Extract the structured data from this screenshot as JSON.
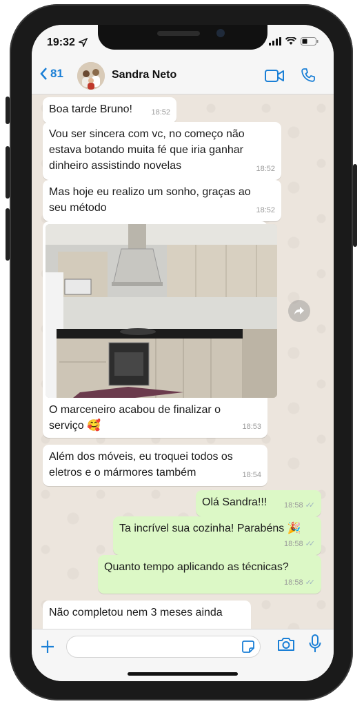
{
  "status": {
    "time": "19:32"
  },
  "header": {
    "back_count": "81",
    "contact_name": "Sandra Neto"
  },
  "messages": [
    {
      "dir": "in",
      "text": "Boa tarde Bruno!",
      "time": "18:52"
    },
    {
      "dir": "in",
      "text": "Vou ser sincera com vc, no começo não estava botando muita fé que iria ganhar dinheiro assistindo novelas",
      "time": "18:52"
    },
    {
      "dir": "in",
      "text": "Mas hoje eu realizo um sonho, graças ao seu método",
      "time": "18:52"
    },
    {
      "dir": "in",
      "type": "image",
      "caption": "O marceneiro acabou de finalizar o serviço 🥰",
      "time": "18:53"
    },
    {
      "dir": "in",
      "text": "Além dos móveis, eu troquei todos os eletros e o mármores também",
      "time": "18:54"
    },
    {
      "dir": "out",
      "text": "Olá Sandra!!!",
      "time": "18:58"
    },
    {
      "dir": "out",
      "text": "Ta incrível sua cozinha! Parabéns 🎉",
      "time": "18:58"
    },
    {
      "dir": "out",
      "text": "Quanto tempo aplicando as técnicas?",
      "time": "18:58"
    },
    {
      "dir": "in",
      "text": "Não completou nem 3 meses ainda",
      "time": ""
    }
  ],
  "colors": {
    "accent": "#1a7fd6",
    "outgoing_bubble": "#dcf8c6",
    "incoming_bubble": "#ffffff",
    "chat_bg": "#ece5dd"
  },
  "icons": [
    "location-arrow-icon",
    "signal-icon",
    "wifi-icon",
    "battery-icon",
    "back-chevron-icon",
    "video-call-icon",
    "phone-call-icon",
    "forward-icon",
    "plus-icon",
    "sticker-icon",
    "camera-icon",
    "microphone-icon",
    "read-receipt-icon"
  ]
}
